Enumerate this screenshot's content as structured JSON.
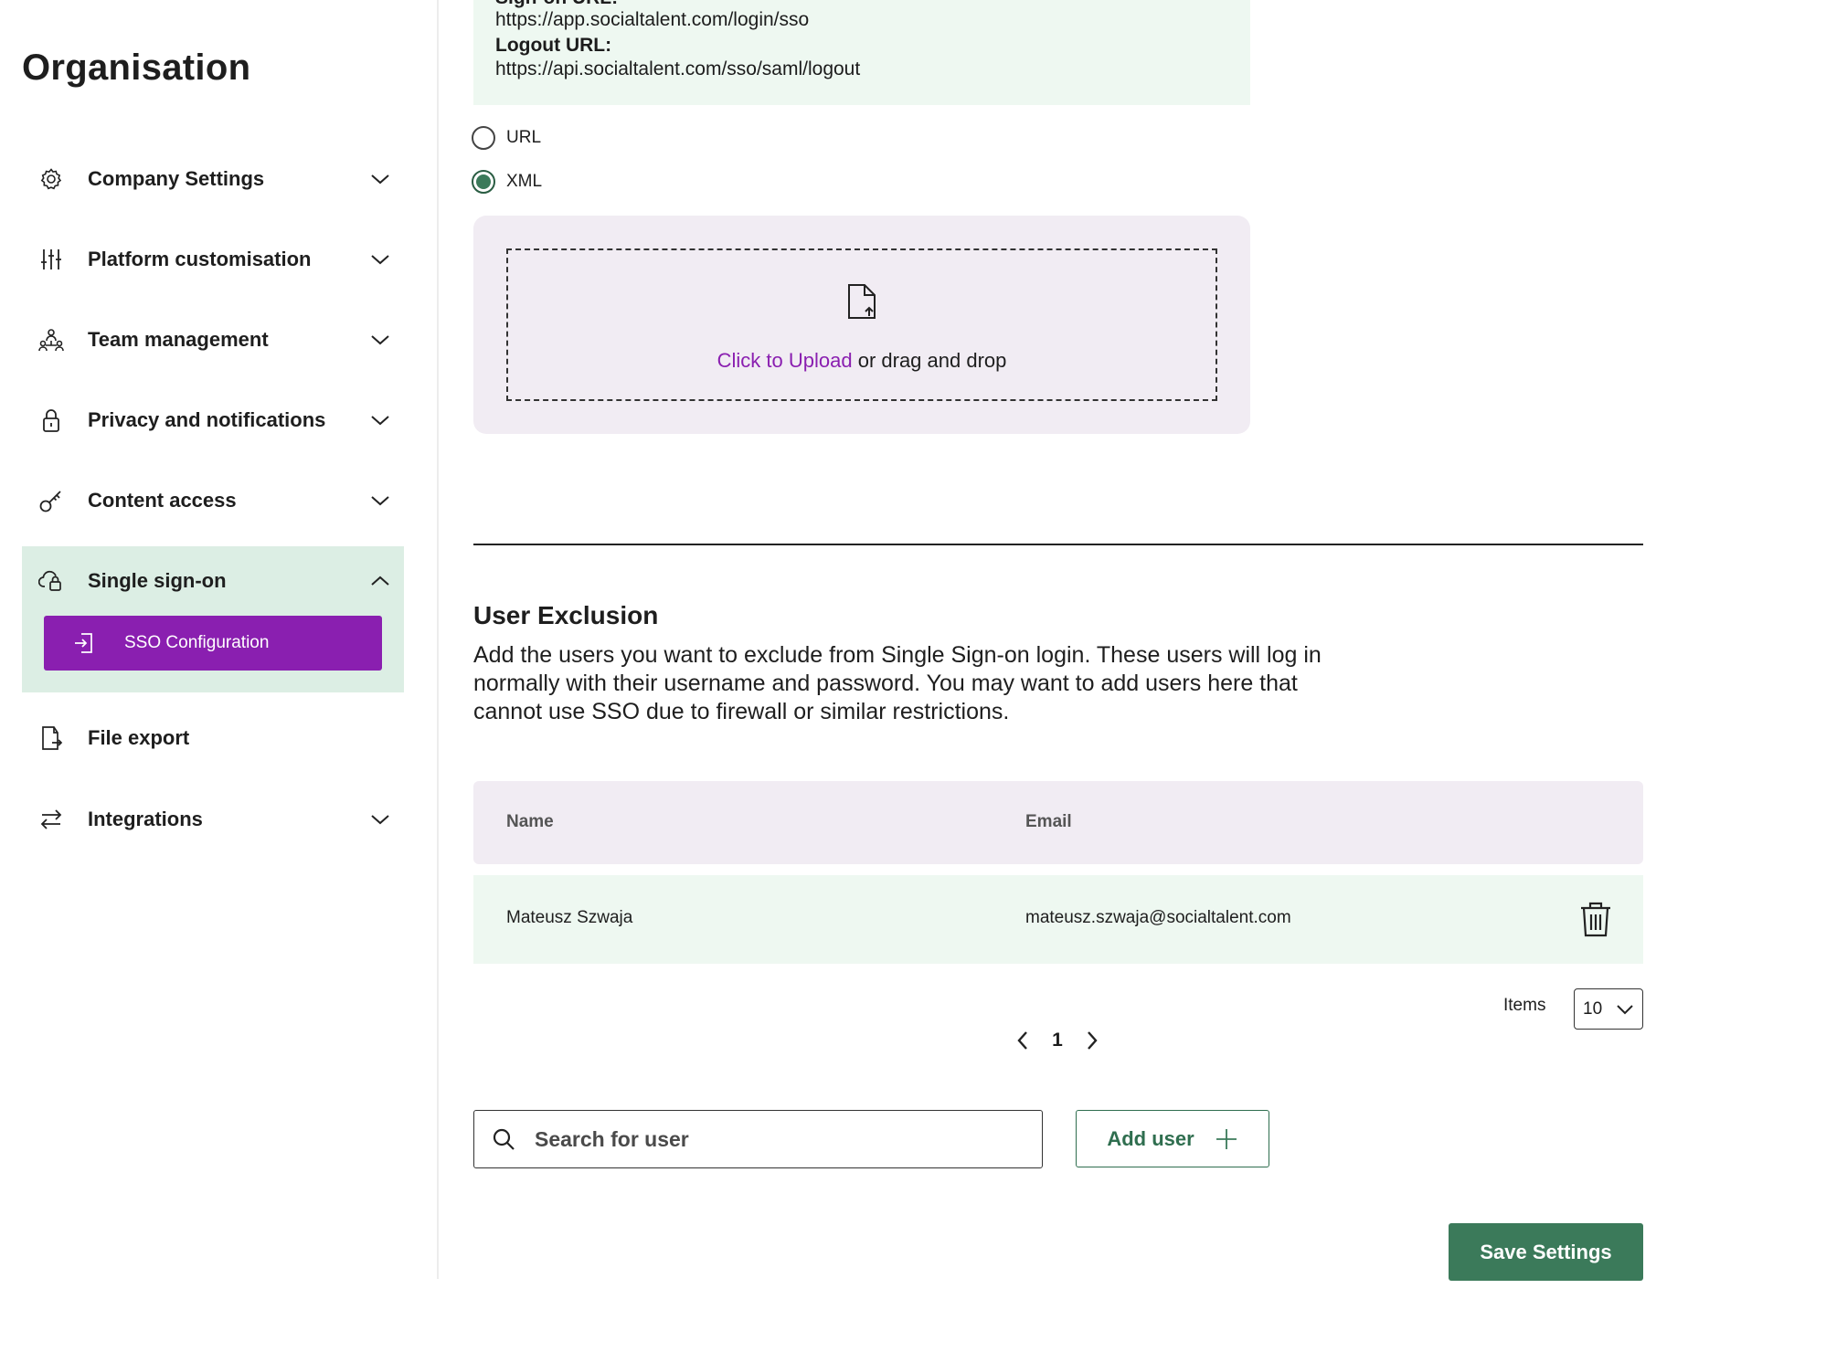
{
  "sidebar": {
    "title": "Organisation",
    "items": [
      {
        "label": "Company Settings",
        "icon": "gear-icon"
      },
      {
        "label": "Platform customisation",
        "icon": "sliders-icon"
      },
      {
        "label": "Team management",
        "icon": "team-icon"
      },
      {
        "label": "Privacy and notifications",
        "icon": "lock-icon"
      },
      {
        "label": "Content access",
        "icon": "key-icon"
      },
      {
        "label": "Single sign-on",
        "icon": "cloud-lock-icon",
        "expanded": true,
        "subitems": [
          {
            "label": "SSO Configuration",
            "icon": "sign-in-icon",
            "active": true
          }
        ]
      },
      {
        "label": "File export",
        "icon": "file-export-icon"
      },
      {
        "label": "Integrations",
        "icon": "arrows-swap-icon"
      }
    ]
  },
  "signon_box": {
    "signon_label_cut": "Sign-on URL:",
    "signon_url": "https://app.socialtalent.com/login/sso",
    "logout_label": "Logout URL:",
    "logout_url": "https://api.socialtalent.com/sso/saml/logout"
  },
  "metadata_source": {
    "options": [
      {
        "label": "URL",
        "selected": false
      },
      {
        "label": "XML",
        "selected": true
      }
    ]
  },
  "upload": {
    "link_text": "Click to Upload",
    "rest_text": "or drag and drop"
  },
  "user_exclusion": {
    "title": "User Exclusion",
    "description": "Add the users you want to exclude from Single Sign-on login. These users will log in normally with their username and password. You may want to add users here that cannot use SSO due to firewall or similar restrictions.",
    "columns": [
      "Name",
      "Email"
    ],
    "rows": [
      {
        "name": "Mateusz Szwaja",
        "email": "mateusz.szwaja@socialtalent.com"
      }
    ],
    "items_label": "Items",
    "items_per_page": "10",
    "current_page": "1",
    "search_placeholder": "Search for user",
    "add_user_label": "Add user"
  },
  "save_label": "Save Settings",
  "colors": {
    "brand_purple": "#8a1fb0",
    "brand_green": "#3b7a5a",
    "mint_bg": "#eef8f1",
    "lavender_bg": "#f1ecf3",
    "sso_group_bg": "#dceee4"
  }
}
